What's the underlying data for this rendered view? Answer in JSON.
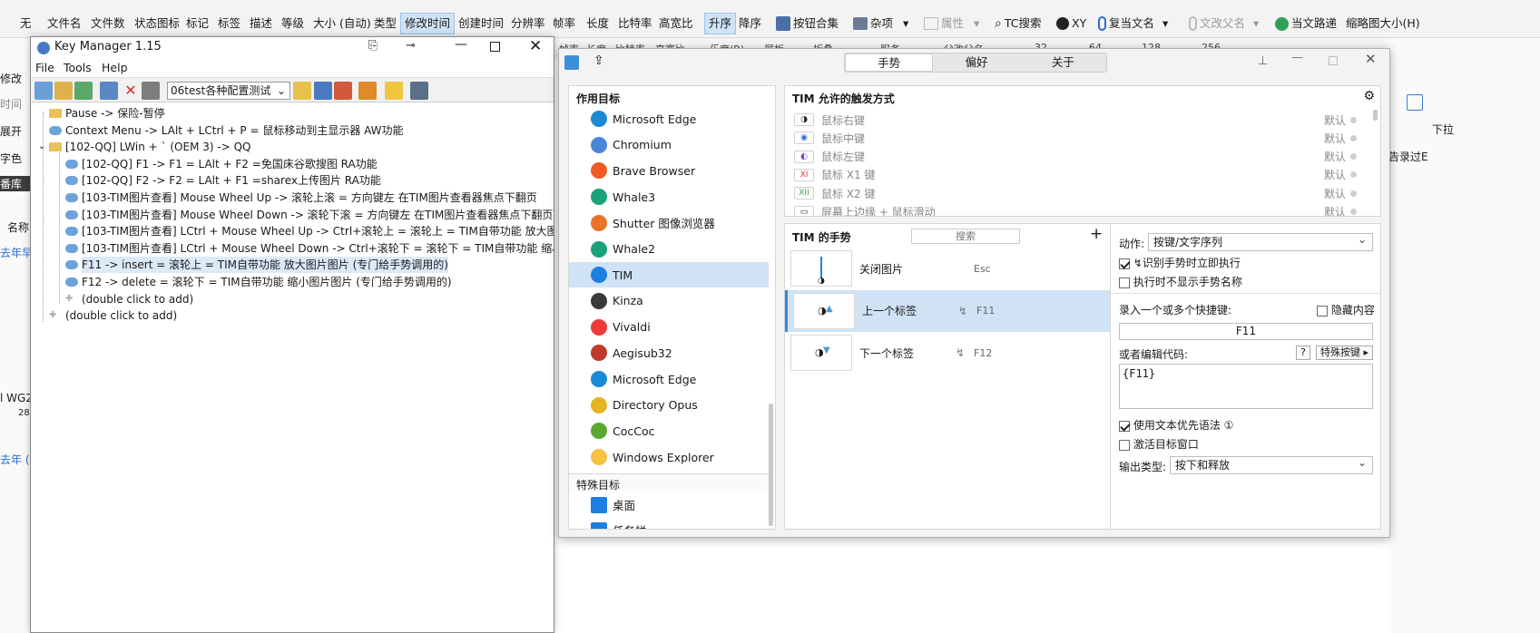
{
  "background": {
    "sort_bar": [
      "无",
      "文件名",
      "文件数",
      "状态图标",
      "标记",
      "标签",
      "描述",
      "等级",
      "大小 (自动)",
      "类型",
      "修改时间",
      "创建时间",
      "分辨率",
      "帧率",
      "长度",
      "比特率",
      "高宽比"
    ],
    "active_sort": "修改时间",
    "order": {
      "asc": "升序",
      "desc": "降序"
    },
    "tools": {
      "button_set": "按钮合集",
      "misc": "杂项",
      "properties": "属性",
      "tc_search": "TC搜索",
      "xy": "XY",
      "copy_name": "复当文名",
      "copy_parent": "文改父名",
      "current_path": "当文路递",
      "thumb_size": "缩略图大小(H)"
    },
    "left_strip": [
      "修改",
      "时间",
      "展开",
      "字色",
      "番库",
      "名称",
      "去年早",
      "l WG2",
      "28.",
      "去年 (1"
    ],
    "right_strip": [
      "下拉",
      "告录过E"
    ],
    "row2": [
      "帧率",
      "长度",
      "比特率",
      "高宽比",
      "乐度(R)",
      "展板",
      "折叠",
      "服务",
      "父改父名",
      "32",
      "64",
      "128",
      "256"
    ]
  },
  "key_manager": {
    "title": "Key Manager 1.15",
    "menu": [
      "File",
      "Tools",
      "Help"
    ],
    "profile": "06test各种配置测试",
    "tree": [
      {
        "level": 1,
        "text": "Pause -> 保险-暂停",
        "icon": "folder"
      },
      {
        "level": 1,
        "text": "Context Menu ->  LAlt + LCtrl + P = 鼠标移动到主显示器 AW功能",
        "icon": "key"
      },
      {
        "level": 1,
        "text": "[102-QQ] LWin + ` (OEM 3) -> QQ",
        "icon": "folder",
        "expanded": true
      },
      {
        "level": 2,
        "text": "[102-QQ] F1 -> F1 = LAlt + F2 =免国床谷歌搜图 RA功能",
        "icon": "key"
      },
      {
        "level": 2,
        "text": "[102-QQ] F2 -> F2 = LAlt + F1 =sharex上传图片 RA功能",
        "icon": "key"
      },
      {
        "level": 2,
        "text": "[103-TIM图片查看] Mouse Wheel Up -> 滚轮上滚 = 方向键左 在TIM图片查看器焦点下翻页",
        "icon": "key"
      },
      {
        "level": 2,
        "text": "[103-TIM图片查看] Mouse Wheel Down -> 滚轮下滚 = 方向键左 在TIM图片查看器焦点下翻页",
        "icon": "key"
      },
      {
        "level": 2,
        "text": "[103-TIM图片查看] LCtrl + Mouse Wheel Up -> Ctrl+滚轮上 = 滚轮上 = TIM自带功能 放大图片",
        "icon": "key"
      },
      {
        "level": 2,
        "text": "[103-TIM图片查看] LCtrl + Mouse Wheel Down -> Ctrl+滚轮下 = 滚轮下 = TIM自带功能 缩小图片图",
        "icon": "key"
      },
      {
        "level": 2,
        "text": "F11 -> insert = 滚轮上 = TIM自带功能 放大图片图片 (专门给手势调用的)",
        "icon": "key",
        "selected": true
      },
      {
        "level": 2,
        "text": "F12 -> delete = 滚轮下  = TIM自带功能 缩小图片图片 (专门给手势调用的)",
        "icon": "key"
      },
      {
        "level": 2,
        "text": "(double click to add)",
        "icon": "add"
      },
      {
        "level": 1,
        "text": "(double click to add)",
        "icon": "add"
      }
    ]
  },
  "gesture_settings": {
    "tabs": [
      "手势",
      "偏好",
      "关于"
    ],
    "active_tab": "手势",
    "targets_header": "作用目标",
    "apps": [
      {
        "name": "Microsoft Edge",
        "color": "#1a8ad6"
      },
      {
        "name": "Chromium",
        "color": "#4a86d8"
      },
      {
        "name": "Brave Browser",
        "color": "#f15a24"
      },
      {
        "name": "Whale3",
        "color": "#1aa37a"
      },
      {
        "name": "Shutter 图像浏览器",
        "color": "#e8732a"
      },
      {
        "name": "Whale2",
        "color": "#1aa37a"
      },
      {
        "name": "TIM",
        "color": "#1e7fe0",
        "selected": true
      },
      {
        "name": "Kinza",
        "color": "#3a3a3a"
      },
      {
        "name": "Vivaldi",
        "color": "#ef3939"
      },
      {
        "name": "Aegisub32",
        "color": "#c0392b"
      },
      {
        "name": "Microsoft Edge",
        "color": "#1a8ad6"
      },
      {
        "name": "Directory Opus",
        "color": "#e6b422"
      },
      {
        "name": "CocCoc",
        "color": "#5aa832"
      },
      {
        "name": "Windows Explorer",
        "color": "#f5c242"
      }
    ],
    "special_header": "特殊目标",
    "special": [
      {
        "name": "桌面",
        "color": "#1e7fe0"
      },
      {
        "name": "任务栏",
        "color": "#1e7fe0"
      }
    ],
    "triggers_header": "TIM 允许的触发方式",
    "triggers": [
      {
        "icon": "◑",
        "name": "鼠标右键",
        "value": "默认"
      },
      {
        "icon": "◉",
        "name": "鼠标中键",
        "value": "默认"
      },
      {
        "icon": "◐",
        "name": "鼠标左键",
        "value": "默认"
      },
      {
        "icon": "XI",
        "name": "鼠标 X1 键",
        "value": "默认"
      },
      {
        "icon": "XII",
        "name": "鼠标 X2 键",
        "value": "默认"
      },
      {
        "icon": "▭",
        "name": "屏幕上边缘 + 鼠标滑动",
        "value": "默认"
      }
    ],
    "gestures_header": "TIM 的手势",
    "search_placeholder": "搜索",
    "gestures": [
      {
        "name": "关闭图片",
        "key": "Esc",
        "direction": "down"
      },
      {
        "name": "上一个标签",
        "key": "F11",
        "direction": "up",
        "selected": true
      },
      {
        "name": "下一个标签",
        "key": "F12",
        "direction": "down"
      }
    ],
    "action": {
      "label": "动作:",
      "type": "按键/文字序列",
      "exec_immediately": "识别手势时立即执行",
      "exec_immediately_checked": true,
      "hide_name": "执行时不显示手势名称",
      "hide_name_checked": false,
      "record_label": "录入一个或多个快捷键:",
      "hide_content": "隐藏内容",
      "hide_content_checked": false,
      "shortcut": "F11",
      "code_label": "或者编辑代码:",
      "help": "?",
      "special_keys": "特殊按键 ▸",
      "code": "{F11}",
      "text_priority": "使用文本优先语法 ①",
      "text_priority_checked": true,
      "activate_window": "激活目标窗口",
      "activate_window_checked": false,
      "output_label": "输出类型:",
      "output_type": "按下和释放"
    }
  }
}
